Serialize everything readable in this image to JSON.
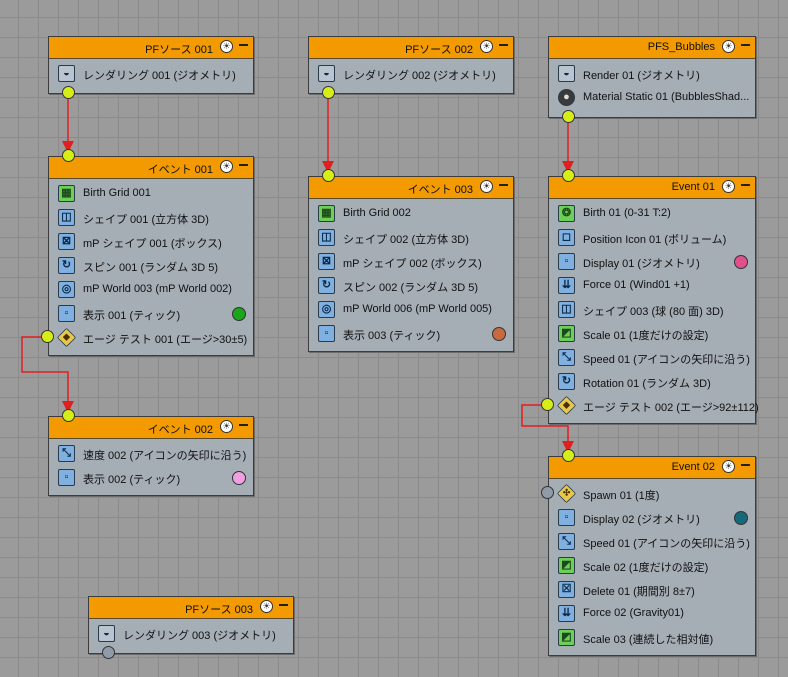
{
  "colors": {
    "canvas": "#9b9b9b",
    "header": "#f39a00",
    "node_body": "#a5adb5",
    "wire": "#e02020",
    "port": "#d6ee18",
    "port_idle": "#8f9ba8"
  },
  "nodes": {
    "pf_source_001": {
      "title": "PFソース 001",
      "ops": [
        {
          "label": "レンダリング 001 (ジオメトリ)",
          "icon": "render-icon"
        }
      ]
    },
    "pf_source_002": {
      "title": "PFソース 002",
      "ops": [
        {
          "label": "レンダリング 002 (ジオメトリ)",
          "icon": "render-icon"
        }
      ]
    },
    "pf_source_003": {
      "title": "PFソース 003",
      "ops": [
        {
          "label": "レンダリング 003 (ジオメトリ)",
          "icon": "render-icon"
        }
      ]
    },
    "pfs_bubbles": {
      "title": "PFS_Bubbles",
      "ops": [
        {
          "label": "Render 01 (ジオメトリ)",
          "icon": "render-icon"
        },
        {
          "label": "Material Static 01 (BubblesShad...",
          "icon": "material-icon"
        }
      ]
    },
    "event_001": {
      "title": "イベント 001",
      "ops": [
        {
          "label": "Birth Grid 001",
          "icon": "birth-grid-icon"
        },
        {
          "label": "シェイプ 001 (立方体 3D)",
          "icon": "shape-icon"
        },
        {
          "label": "mP シェイプ 001 (ボックス)",
          "icon": "mp-shape-icon"
        },
        {
          "label": "スピン 001 (ランダム 3D 5)",
          "icon": "spin-icon"
        },
        {
          "label": "mP World 003 (mP World 002)",
          "icon": "mp-world-icon"
        },
        {
          "label": "表示 001 (ティック)",
          "icon": "display-icon",
          "color": "#1aa51a"
        },
        {
          "label": "エージ テスト 001 (エージ>30±5)",
          "icon": "age-test-icon"
        }
      ]
    },
    "event_002": {
      "title": "イベント 002",
      "ops": [
        {
          "label": "速度 002 (アイコンの矢印に沿う)",
          "icon": "speed-icon"
        },
        {
          "label": "表示 002 (ティック)",
          "icon": "display-icon",
          "color": "#f0a0e0"
        }
      ]
    },
    "event_003": {
      "title": "イベント 003",
      "ops": [
        {
          "label": "Birth Grid 002",
          "icon": "birth-grid-icon"
        },
        {
          "label": "シェイプ 002 (立方体 3D)",
          "icon": "shape-icon"
        },
        {
          "label": "mP シェイプ 002 (ボックス)",
          "icon": "mp-shape-icon"
        },
        {
          "label": "スピン 002 (ランダム 3D 5)",
          "icon": "spin-icon"
        },
        {
          "label": "mP World 006 (mP World 005)",
          "icon": "mp-world-icon"
        },
        {
          "label": "表示 003 (ティック)",
          "icon": "display-icon",
          "color": "#c86a40"
        }
      ]
    },
    "event_01": {
      "title": "Event 01",
      "ops": [
        {
          "label": "Birth 01 (0-31 T:2)",
          "icon": "birth-icon"
        },
        {
          "label": "Position Icon 01 (ボリューム)",
          "icon": "position-icon"
        },
        {
          "label": "Display 01 (ジオメトリ)",
          "icon": "display-icon",
          "color": "#e0508a"
        },
        {
          "label": "Force 01 (Wind01 +1)",
          "icon": "force-icon"
        },
        {
          "label": "シェイプ 003 (球 (80 面) 3D)",
          "icon": "shape-icon"
        },
        {
          "label": "Scale 01 (1度だけの設定)",
          "icon": "scale-icon"
        },
        {
          "label": "Speed 01 (アイコンの矢印に沿う)",
          "icon": "speed-icon"
        },
        {
          "label": "Rotation 01 (ランダム 3D)",
          "icon": "rotation-icon"
        },
        {
          "label": "エージ テスト 002 (エージ>92±112)",
          "icon": "age-test-icon"
        }
      ]
    },
    "event_02": {
      "title": "Event 02",
      "ops": [
        {
          "label": "Spawn 01 (1度)",
          "icon": "spawn-icon"
        },
        {
          "label": "Display 02 (ジオメトリ)",
          "icon": "display-icon",
          "color": "#15697a"
        },
        {
          "label": "Speed 01 (アイコンの矢印に沿う)",
          "icon": "speed-icon"
        },
        {
          "label": "Scale 02 (1度だけの設定)",
          "icon": "scale-icon"
        },
        {
          "label": "Delete 01 (期間別 8±7)",
          "icon": "delete-icon"
        },
        {
          "label": "Force 02 (Gravity01)",
          "icon": "force-icon"
        },
        {
          "label": "Scale 03 (連続した相対値)",
          "icon": "scale-icon"
        }
      ]
    }
  }
}
